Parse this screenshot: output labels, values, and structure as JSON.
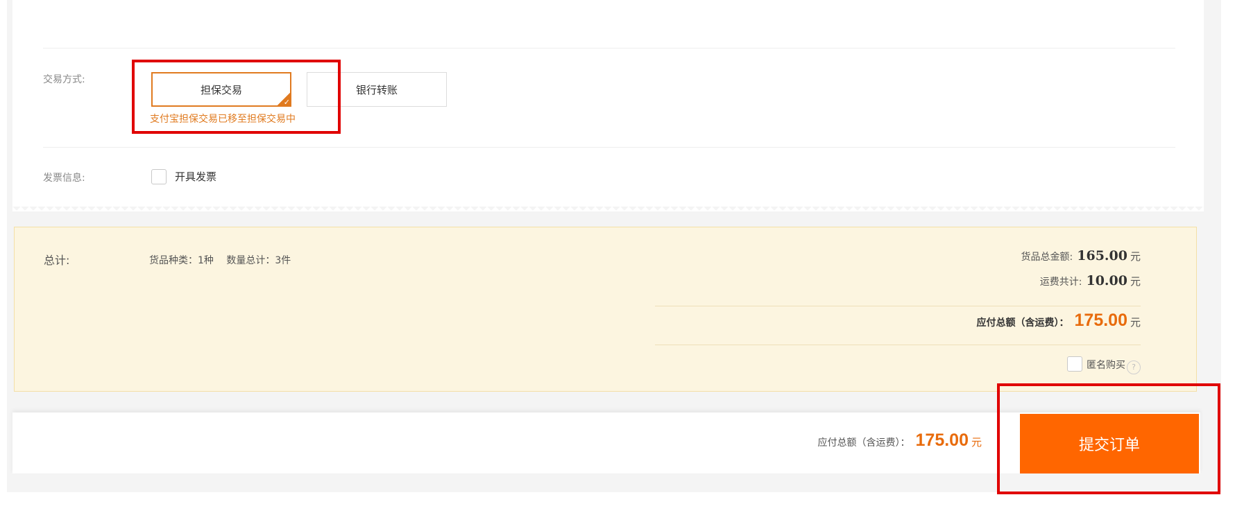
{
  "payment": {
    "label": "交易方式:",
    "options": [
      "担保交易",
      "银行转账"
    ],
    "selected_index": 0,
    "note": "支付宝担保交易已移至担保交易中"
  },
  "invoice": {
    "label": "发票信息:",
    "checkbox_label": "开具发票"
  },
  "summary": {
    "label": "总计:",
    "product_types": "货品种类：1种",
    "total_quantity": "数量总计：3件",
    "goods_total_label": "货品总金额:",
    "goods_total_value": "165.00",
    "shipping_label": "运费共计:",
    "shipping_value": "10.00",
    "payable_label": "应付总额（含运费）：",
    "payable_value": "175.00",
    "currency": "元",
    "anonymous_label": "匿名购买",
    "help_icon_glyph": "?"
  },
  "footer": {
    "payable_label": "应付总额（含运费）：",
    "payable_value": "175.00",
    "currency": "元",
    "submit_label": "提交订单"
  },
  "colors": {
    "accent_orange": "#ff6600",
    "amount_orange": "#e86b0c",
    "highlight_red": "#e00000",
    "summary_bg": "#fcf5e0"
  }
}
